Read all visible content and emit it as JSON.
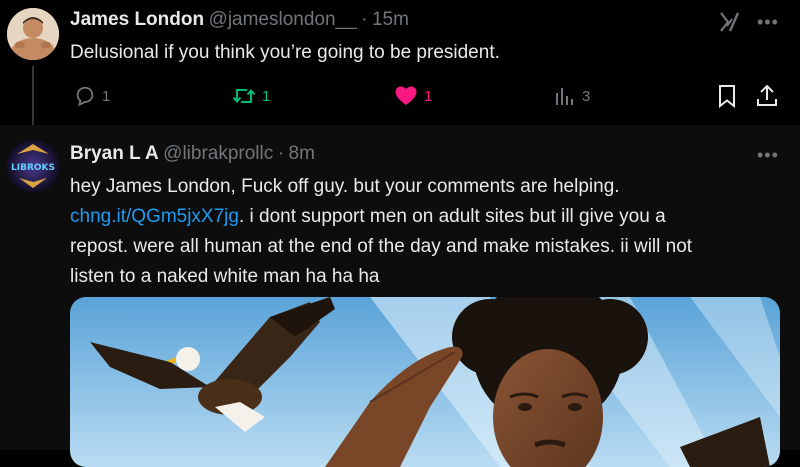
{
  "tweet1": {
    "display_name": "James London",
    "handle": "@jameslondon__",
    "separator": "·",
    "time": "15m",
    "text": "Delusional if you think you’re going to be president.",
    "actions": {
      "replies": "1",
      "reposts": "1",
      "likes": "1",
      "views": "3"
    },
    "colors": {
      "repost": "#00ba7c",
      "like": "#f91880"
    }
  },
  "tweet2": {
    "display_name": "Bryan L A",
    "handle": "@librakprollc",
    "separator": "·",
    "time": "8m",
    "avatar_text": "LIBROKS",
    "text_part1": "hey James London, Fuck off guy. but your comments are helping.",
    "link": "chng.it/QGm5jxX7jg",
    "text_part2": ". i dont support men on adult sites but ill give you a",
    "text_part3": "repost. were all human at the end of the day and make mistakes. ii will not",
    "text_part4": "listen to a naked white man ha ha ha"
  },
  "colors": {
    "background": "#000000",
    "text": "#e7e9ea",
    "muted": "#71767b",
    "link": "#1d9bf0"
  }
}
